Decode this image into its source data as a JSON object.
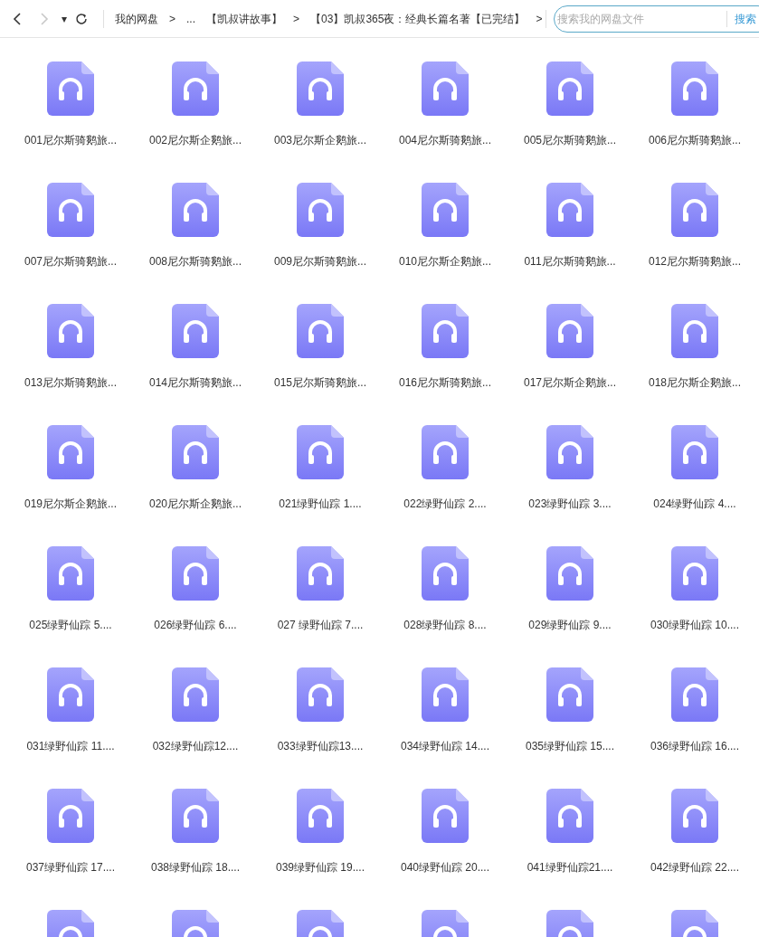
{
  "toolbar": {
    "back": {
      "disabled": false
    },
    "forward": {
      "disabled": true
    },
    "dropdown": "▾",
    "breadcrumbs": [
      {
        "label": "我的网盘",
        "separator": ">"
      },
      {
        "label": "..."
      },
      {
        "label": "【凯叔讲故事】",
        "separator": ">"
      },
      {
        "label": "【03】凯叔365夜：经典长篇名著【已完结】",
        "separator": ">"
      }
    ],
    "search": {
      "placeholder": "搜索我的网盘文件",
      "button": "搜索"
    }
  },
  "files": [
    {
      "name": "001尼尔斯骑鹅旅..."
    },
    {
      "name": "002尼尔斯企鹅旅..."
    },
    {
      "name": "003尼尔斯企鹅旅..."
    },
    {
      "name": "004尼尔斯骑鹅旅..."
    },
    {
      "name": "005尼尔斯骑鹅旅..."
    },
    {
      "name": "006尼尔斯骑鹅旅..."
    },
    {
      "name": "007尼尔斯骑鹅旅..."
    },
    {
      "name": "008尼尔斯骑鹅旅..."
    },
    {
      "name": "009尼尔斯骑鹅旅..."
    },
    {
      "name": "010尼尔斯企鹅旅..."
    },
    {
      "name": "011尼尔斯骑鹅旅..."
    },
    {
      "name": "012尼尔斯骑鹅旅..."
    },
    {
      "name": "013尼尔斯骑鹅旅..."
    },
    {
      "name": "014尼尔斯骑鹅旅..."
    },
    {
      "name": "015尼尔斯骑鹅旅..."
    },
    {
      "name": "016尼尔斯骑鹅旅..."
    },
    {
      "name": "017尼尔斯企鹅旅..."
    },
    {
      "name": "018尼尔斯企鹅旅..."
    },
    {
      "name": "019尼尔斯企鹅旅..."
    },
    {
      "name": "020尼尔斯企鹅旅..."
    },
    {
      "name": "021绿野仙踪 1...."
    },
    {
      "name": "022绿野仙踪 2...."
    },
    {
      "name": "023绿野仙踪 3...."
    },
    {
      "name": "024绿野仙踪 4...."
    },
    {
      "name": "025绿野仙踪 5...."
    },
    {
      "name": "026绿野仙踪 6...."
    },
    {
      "name": "027 绿野仙踪 7...."
    },
    {
      "name": "028绿野仙踪 8...."
    },
    {
      "name": "029绿野仙踪 9...."
    },
    {
      "name": "030绿野仙踪 10...."
    },
    {
      "name": "031绿野仙踪 11...."
    },
    {
      "name": "032绿野仙踪12...."
    },
    {
      "name": "033绿野仙踪13...."
    },
    {
      "name": "034绿野仙踪 14...."
    },
    {
      "name": "035绿野仙踪 15...."
    },
    {
      "name": "036绿野仙踪 16...."
    },
    {
      "name": "037绿野仙踪 17...."
    },
    {
      "name": "038绿野仙踪 18...."
    },
    {
      "name": "039绿野仙踪 19...."
    },
    {
      "name": "040绿野仙踪 20...."
    },
    {
      "name": "041绿野仙踪21...."
    },
    {
      "name": "042绿野仙踪 22...."
    },
    {
      "kind": "audio"
    },
    {
      "kind": "audio"
    },
    {
      "kind": "audio"
    },
    {
      "kind": "audio"
    },
    {
      "kind": "audio"
    },
    {
      "kind": "audio"
    }
  ]
}
